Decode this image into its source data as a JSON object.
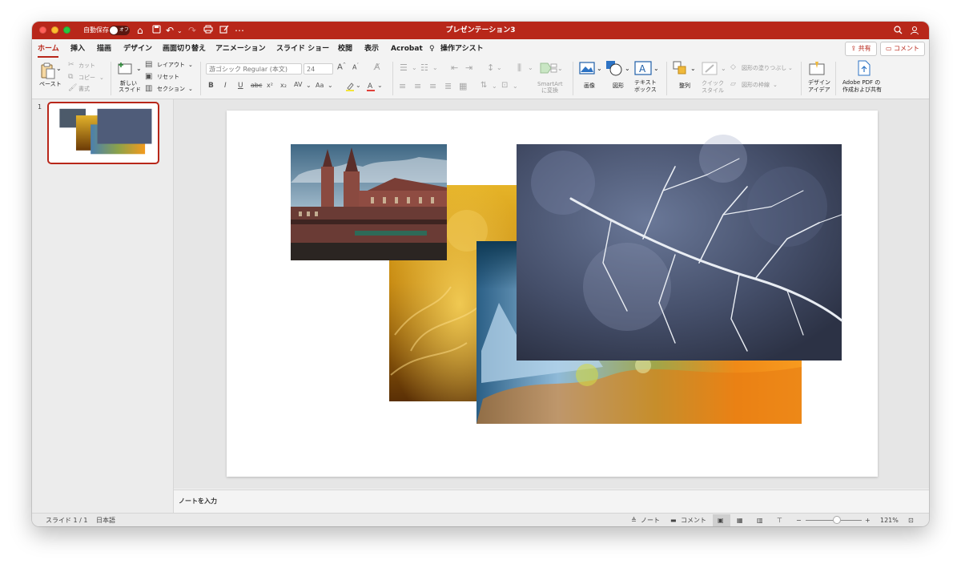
{
  "window": {
    "title": "プレゼンテーション3"
  },
  "titlebar": {
    "autosave_label": "自動保存",
    "autosave_state": "オフ"
  },
  "tabs": [
    "ホーム",
    "挿入",
    "描画",
    "デザイン",
    "画面切り替え",
    "アニメーション",
    "スライド ショー",
    "校閲",
    "表示",
    "Acrobat",
    "操作アシスト"
  ],
  "actions": {
    "share": "共有",
    "comment": "コメント"
  },
  "ribbon": {
    "paste": "ペースト",
    "cut": "カット",
    "copy": "コピー",
    "format": "書式",
    "new_slide_1": "新しい",
    "new_slide_2": "スライド",
    "layout": "レイアウト",
    "reset": "リセット",
    "section": "セクション",
    "font_name": "游ゴシック Regular (本文)",
    "font_size": "24",
    "smartart_1": "SmartArt",
    "smartart_2": "に変換",
    "image": "画像",
    "shape": "図形",
    "textbox_1": "テキスト",
    "textbox_2": "ボックス",
    "arrange": "整列",
    "quick_style_1": "クイック",
    "quick_style_2": "スタイル",
    "shape_fill": "図形の塗りつぶし",
    "shape_outline": "図形の枠線",
    "design_idea_1": "デザイン",
    "design_idea_2": "アイデア",
    "adobe_pdf_1": "Adobe PDF の",
    "adobe_pdf_2": "作成および共有"
  },
  "thumbnails": [
    {
      "number": "1"
    }
  ],
  "notes": {
    "placeholder": "ノートを入力"
  },
  "status": {
    "slide_count": "スライド 1 / 1",
    "language": "日本語",
    "notes": "ノート",
    "comments": "コメント",
    "zoom": "121%",
    "zoom_level": 0.55
  }
}
